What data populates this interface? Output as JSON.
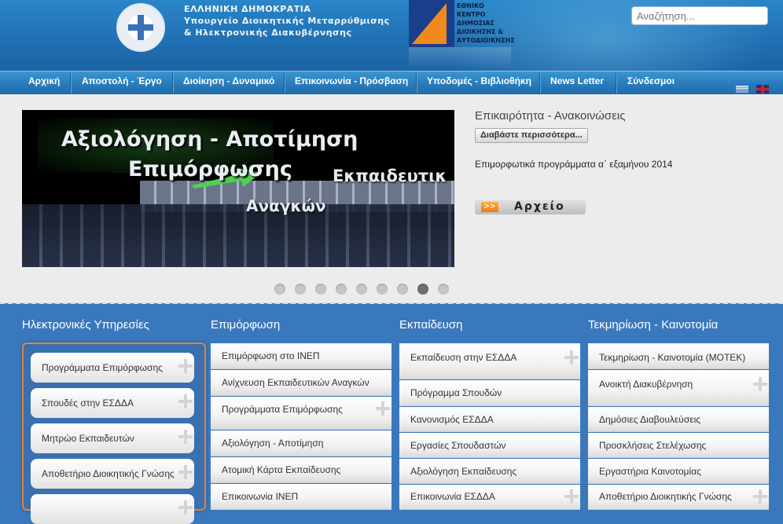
{
  "header": {
    "ministry_line1": "ΕΛΛΗΝΙΚΗ ΔΗΜΟΚΡΑΤΙΑ",
    "ministry_line2": "Υπουργείο Διοικητικής Μεταρρύθμισης",
    "ministry_line3": "& Ηλεκτρονικής Διακυβέρνησης",
    "ekdda_lines": [
      "ΕΘΝΙΚΟ",
      "ΚΕΝΤΡΟ",
      "ΔΗΜΟΣΙΑΣ",
      "ΔΙΟΙΚΗΣΗΣ &",
      "ΑΥΤΟΔΙΟΙΚΗΣΗΣ"
    ],
    "search_placeholder": "Αναζήτηση..."
  },
  "nav": {
    "items": [
      "Αρχική",
      "Αποστολή - Έργο",
      "Διοίκηση - Δυναμικό",
      "Επικοινωνία - Πρόσβαση",
      "Υποδομές - Βιβλιοθήκη",
      "News Letter",
      "Σύνδεσμοι"
    ]
  },
  "slider": {
    "line1": "Αξιολόγηση - Αποτίμηση",
    "line2": "Επιμόρφωσης",
    "line3": "Εκπαιδευτικ",
    "line4": "Αναγκών",
    "dot_count": 9,
    "active_dot": 8
  },
  "news": {
    "title": "Επικαιρότητα - Ανακοινώσεις",
    "read_more": "Διαβάστε περισσότερα...",
    "text": "Επιμορφωτικά προγράμματα α΄ εξαμήνου 2014",
    "archive_icon": ">>",
    "archive": "Αρχείο"
  },
  "columns": {
    "services": {
      "title": "Ηλεκτρονικές Υπηρεσίες",
      "items": [
        "Προγράμματα Επιμόρφωσης",
        "Σπουδές στην ΕΣΔΔΑ",
        "Μητρώο Εκπαιδευτών",
        "Αποθετήριο Διοικητικής Γνώσης"
      ]
    },
    "training": {
      "title": "Επιμόρφωση",
      "items": [
        "Επιμόρφωση στο ΙΝΕΠ",
        "Ανίχνευση Εκπαιδευτικών Αναγκών",
        "Προγράμματα Επιμόρφωσης",
        "Αξιολόγηση - Αποτίμηση",
        "Ατομική Κάρτα Εκπαίδευσης",
        "Επικοινωνία ΙΝΕΠ"
      ]
    },
    "education": {
      "title": "Εκπαίδευση",
      "items": [
        "Εκπαίδευση στην ΕΣΔΔΑ",
        "Πρόγραμμα Σπουδών",
        "Κανονισμός ΕΣΔΔΑ",
        "Εργασίες Σπουδαστών",
        "Αξιολόγηση Εκπαίδευσης",
        "Επικοινωνία ΕΣΔΔΑ"
      ]
    },
    "innovation": {
      "title": "Τεκμηρίωση - Καινοτομία",
      "items": [
        "Τεκμηρίωση - Καινοτομία (ΜΟΤΕΚ)",
        "Ανοικτή Διακυβέρνηση",
        "Δημόσιες Διαβουλεύσεις",
        "Προσκλήσεις Στελέχωσης",
        "Εργαστήρια Καινοτομίας",
        "Αποθετήριο Διοικητικής Γνώσης"
      ]
    }
  }
}
